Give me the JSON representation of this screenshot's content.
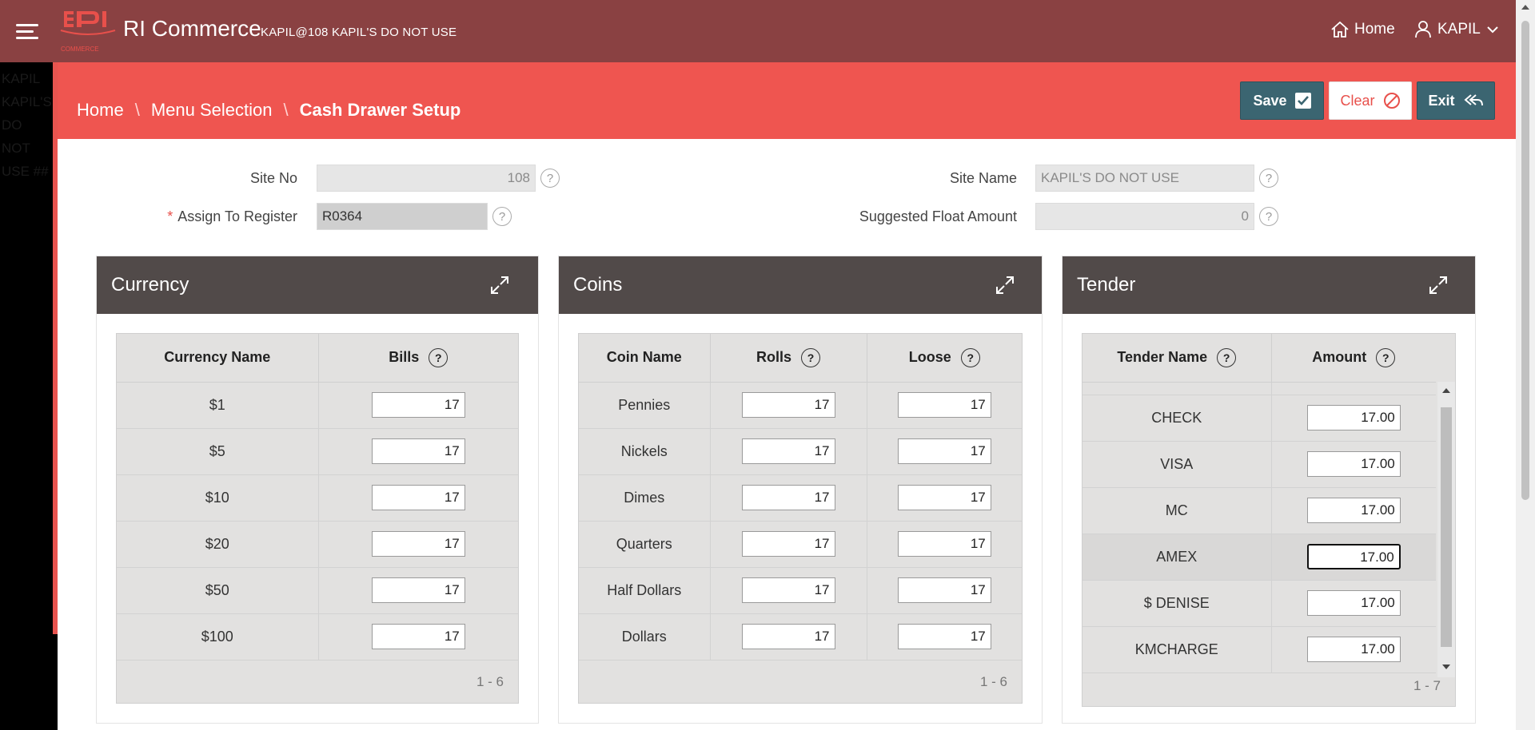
{
  "header": {
    "app_title": "RI Commerce",
    "subtitle": "KAPIL@108 KAPIL'S DO NOT USE",
    "logo_text": "COMMERCE",
    "home_label": "Home",
    "user_label": "KAPIL"
  },
  "left_strip": {
    "ghost_text": "KAPIL KAPIL'S DO NOT USE ##"
  },
  "breadcrumb": {
    "home": "Home",
    "menu": "Menu Selection",
    "current": "Cash Drawer Setup"
  },
  "toolbar": {
    "save_label": "Save",
    "clear_label": "Clear",
    "exit_label": "Exit"
  },
  "form": {
    "site_no_label": "Site No",
    "site_no_value": "108",
    "site_name_label": "Site Name",
    "site_name_value": "KAPIL'S DO NOT USE",
    "register_label": "Assign To Register",
    "register_value": "R0364",
    "float_label": "Suggested Float Amount",
    "float_value": "0",
    "help_glyph": "?"
  },
  "currency": {
    "title": "Currency",
    "col_name": "Currency Name",
    "col_bills": "Bills",
    "rows": [
      {
        "name": "$1",
        "bills": "17"
      },
      {
        "name": "$5",
        "bills": "17"
      },
      {
        "name": "$10",
        "bills": "17"
      },
      {
        "name": "$20",
        "bills": "17"
      },
      {
        "name": "$50",
        "bills": "17"
      },
      {
        "name": "$100",
        "bills": "17"
      }
    ],
    "pager": "1 - 6"
  },
  "coins": {
    "title": "Coins",
    "col_name": "Coin Name",
    "col_rolls": "Rolls",
    "col_loose": "Loose",
    "rows": [
      {
        "name": "Pennies",
        "rolls": "17",
        "loose": "17"
      },
      {
        "name": "Nickels",
        "rolls": "17",
        "loose": "17"
      },
      {
        "name": "Dimes",
        "rolls": "17",
        "loose": "17"
      },
      {
        "name": "Quarters",
        "rolls": "17",
        "loose": "17"
      },
      {
        "name": "Half Dollars",
        "rolls": "17",
        "loose": "17"
      },
      {
        "name": "Dollars",
        "rolls": "17",
        "loose": "17"
      }
    ],
    "pager": "1 - 6"
  },
  "tender": {
    "title": "Tender",
    "col_name": "Tender Name",
    "col_amount": "Amount",
    "rows": [
      {
        "name": "CHECK",
        "amount": "17.00"
      },
      {
        "name": "VISA",
        "amount": "17.00"
      },
      {
        "name": "MC",
        "amount": "17.00"
      },
      {
        "name": "AMEX",
        "amount": "17.00"
      },
      {
        "name": "$ DENISE",
        "amount": "17.00"
      },
      {
        "name": "KMCHARGE",
        "amount": "17.00"
      }
    ],
    "pager": "1 - 7"
  },
  "colors": {
    "topbar": "#8a4142",
    "band": "#ef5550",
    "panel_head": "#514a49",
    "button_primary": "#3b6571",
    "accent_red": "#e8504b"
  }
}
